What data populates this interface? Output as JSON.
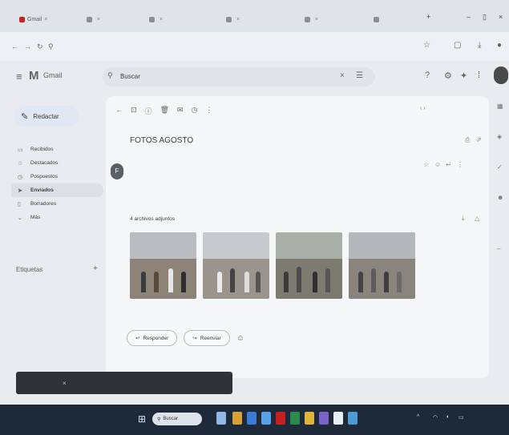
{
  "browser": {
    "tabs": [
      {
        "label": "Gmail"
      },
      {
        "label": ""
      },
      {
        "label": ""
      },
      {
        "label": ""
      },
      {
        "label": ""
      },
      {
        "label": ""
      }
    ],
    "url": ""
  },
  "gmail": {
    "logo_text": "Gmail",
    "search_value": "Buscar",
    "compose_label": "Redactar",
    "nav": [
      {
        "label": "Recibidos",
        "count": "",
        "icon": "inbox-icon"
      },
      {
        "label": "Destacados",
        "count": "",
        "icon": "star-icon"
      },
      {
        "label": "Pospuestos",
        "count": "",
        "icon": "clock-icon"
      },
      {
        "label": "Enviados",
        "count": "",
        "icon": "send-icon",
        "active": true
      },
      {
        "label": "Borradores",
        "count": "",
        "icon": "draft-icon"
      },
      {
        "label": "Más",
        "count": "",
        "icon": "chevron-down-icon"
      }
    ],
    "labels_title": "Etiquetas"
  },
  "message": {
    "subject": "FOTOS AGOSTO",
    "sender_initial": "F",
    "sender_name": "",
    "sender_email": "",
    "to_line": "",
    "date": "",
    "attachments_header": "4 archivos adjuntos",
    "attachments_scan": "",
    "attachments": [
      {
        "name": "photo-1",
        "sky": "#b9bcc0",
        "ground": "#8d8378"
      },
      {
        "name": "photo-2",
        "sky": "#c7c9cc",
        "ground": "#9a948c"
      },
      {
        "name": "photo-3",
        "sky": "#a9b0a8",
        "ground": "#7d7a70"
      },
      {
        "name": "photo-4",
        "sky": "#b3b8bb",
        "ground": "#8a857c"
      }
    ],
    "reply_label": "Responder",
    "forward_label": "Reenviar"
  },
  "snackbar": {
    "text": "",
    "action_1": "",
    "action_2": ""
  },
  "taskbar": {
    "weather_line1": "",
    "weather_line2": "",
    "search_placeholder": "Buscar",
    "clock_time": "",
    "clock_date": ""
  },
  "colors": {
    "page_bg": "#e9ebee",
    "pane_bg": "#f6f7f8",
    "snackbar_bg": "#2f3337",
    "taskbar_bg": "#1e2a3a"
  }
}
